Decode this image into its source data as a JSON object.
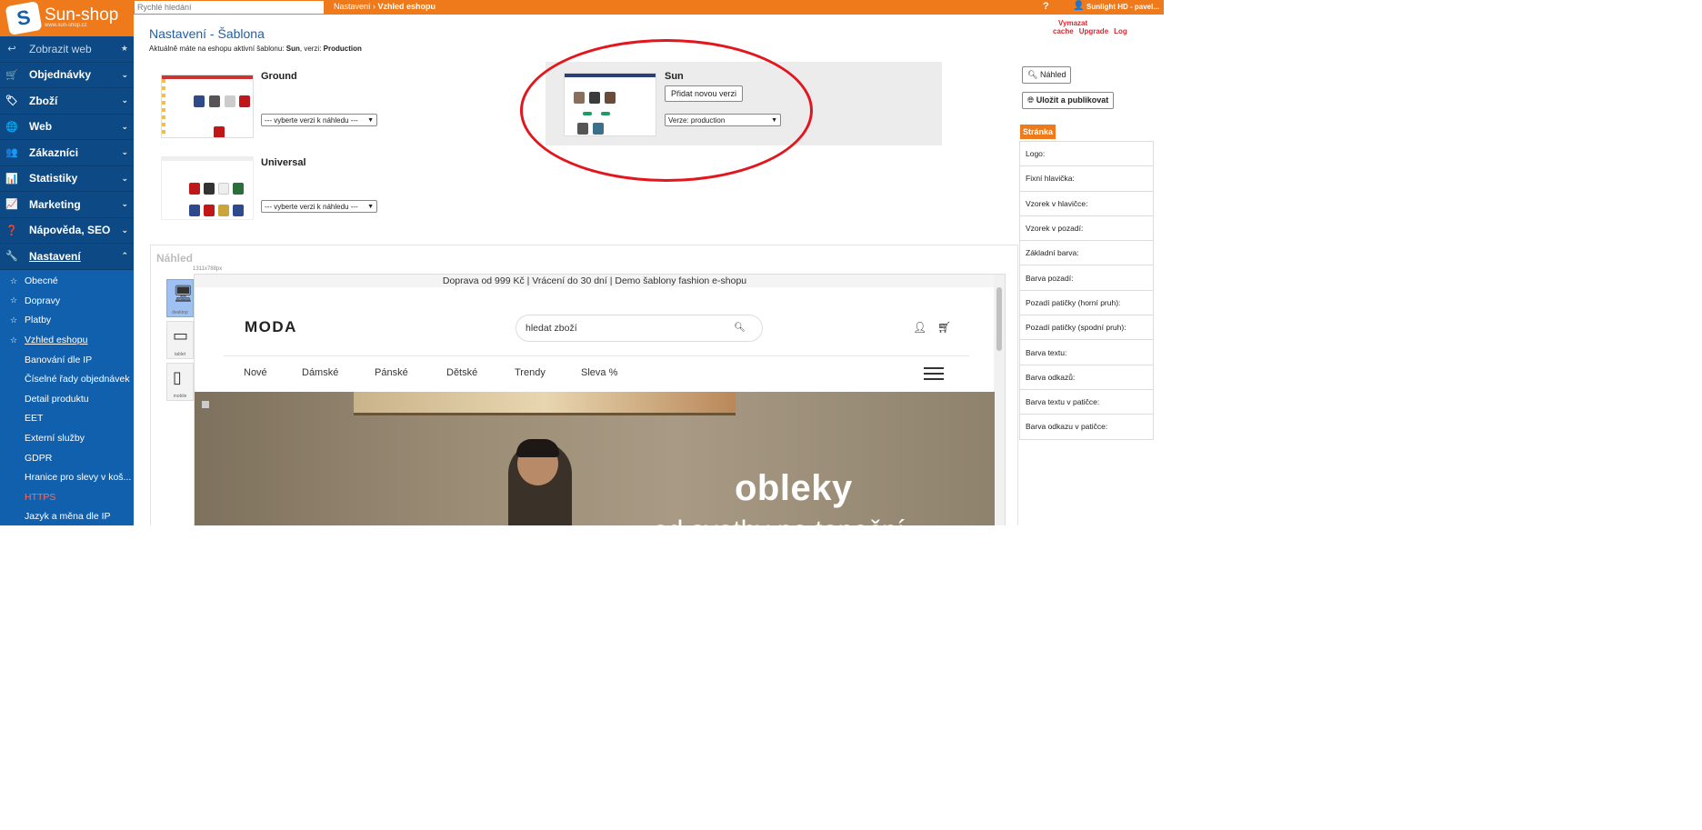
{
  "app": {
    "logo": "Sun-shop",
    "logo_sub": "www.sun-shop.cz"
  },
  "sidebar": {
    "main": [
      {
        "icon": "↩",
        "label": "Zobrazit web",
        "chev": "★"
      },
      {
        "icon": "🛒",
        "label": "Objednávky",
        "chev": "⌄"
      },
      {
        "icon": "🏷",
        "label": "Zboží",
        "chev": "⌄"
      },
      {
        "icon": "🌐",
        "label": "Web",
        "chev": "⌄"
      },
      {
        "icon": "👥",
        "label": "Zákazníci",
        "chev": "⌄"
      },
      {
        "icon": "📊",
        "label": "Statistiky",
        "chev": "⌄"
      },
      {
        "icon": "📈",
        "label": "Marketing",
        "chev": "⌄"
      },
      {
        "icon": "❓",
        "label": "Nápověda, SEO",
        "chev": "⌄"
      },
      {
        "icon": "🔧",
        "label": "Nastavení",
        "chev": "⌃"
      }
    ],
    "sub": [
      {
        "label": "Obecné"
      },
      {
        "label": "Dopravy"
      },
      {
        "label": "Platby"
      },
      {
        "label": "Vzhled eshopu"
      },
      {
        "label": "Banování dle IP"
      },
      {
        "label": "Číselné řady objednávek"
      },
      {
        "label": "Detail produktu"
      },
      {
        "label": "EET"
      },
      {
        "label": "Externí služby"
      },
      {
        "label": "GDPR"
      },
      {
        "label": "Hranice pro slevy v koš..."
      },
      {
        "label": "HTTPS"
      },
      {
        "label": "Jazyk a měna dle IP"
      }
    ]
  },
  "topbar": {
    "search_placeholder": "Rychlé hledání",
    "crumb_parent": "Nastavení",
    "crumb_sep": " › ",
    "crumb_current": "Vzhled eshopu",
    "help": "?",
    "user": "Sunlight HD - pavel...",
    "links": [
      "Vymazat cache",
      "Upgrade",
      "Log"
    ]
  },
  "page": {
    "title": "Nastavení - Šablona",
    "info_prefix": "Aktuálně máte na eshopu aktivní šablonu: ",
    "info_template": "Sun",
    "info_mid": ", verzi: ",
    "info_version": "Production"
  },
  "templates": {
    "ground": {
      "name": "Ground",
      "select": "--- vyberte verzi k náhledu ---"
    },
    "universal": {
      "name": "Universal",
      "select": "--- vyberte verzi k náhledu ---"
    },
    "sun": {
      "name": "Sun",
      "add_button": "Přidat novou verzi",
      "select": "Verze: production"
    }
  },
  "right_panel": {
    "preview_button": "Náhled",
    "publish_button": "Uložit a publikovat",
    "section_tab": "Stránka",
    "rows": [
      "Logo:",
      "Fixní hlavička:",
      "Vzorek v hlavičce:",
      "Vzorek v pozadí:",
      "Základní barva:",
      "Barva pozadí:",
      "Pozadí patičky (horní pruh):",
      "Pozadí patičky (spodní pruh):",
      "Barva textu:",
      "Barva odkazů:",
      "Barva textu v patičce:",
      "Barva odkazu v patičce:"
    ]
  },
  "preview": {
    "label": "Náhled",
    "resolution": "1311x788px",
    "devices": [
      "desktop",
      "tablet",
      "mobile"
    ],
    "shop": {
      "announcement": "Doprava od 999 Kč | Vrácení do 30 dní | Demo šablony fashion e-shopu",
      "logo": "MODA",
      "search_placeholder": "hledat zboží",
      "categories": [
        "Nové",
        "Dámské",
        "Pánské",
        "Dětské",
        "Trendy",
        "Sleva %"
      ],
      "hero_title": "obleky",
      "hero_subtitle": "od svatby po taneční"
    }
  },
  "colors": {
    "accent": "#ee7a1c",
    "sidebar": "#0d4a85",
    "sidebar_sub": "#1160ad",
    "highlight": "#e3161e",
    "title": "#1e5fa8"
  }
}
